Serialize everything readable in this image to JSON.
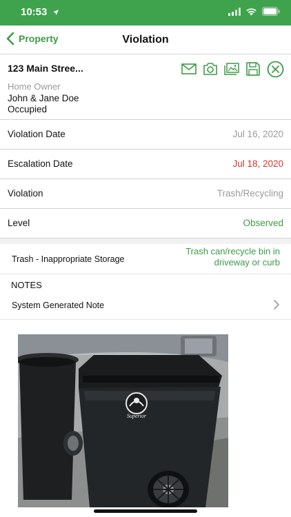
{
  "status_bar": {
    "time": "10:53",
    "background": "#3fa34d"
  },
  "nav": {
    "back_label": "Property",
    "title": "Violation",
    "accent": "#3b9b45"
  },
  "property": {
    "address": "123 Main Stree...",
    "owner_label": "Home Owner",
    "owner_name": "John & Jane Doe",
    "occupancy": "Occupied",
    "actions": [
      "mail-icon",
      "camera-icon",
      "photo-library-icon",
      "save-icon",
      "close-circle-icon"
    ]
  },
  "details": [
    {
      "label": "Violation Date",
      "value": "Jul 16, 2020",
      "color": "#9a9a9a"
    },
    {
      "label": "Escalation Date",
      "value": "Jul 18, 2020",
      "color": "#d9322b"
    },
    {
      "label": "Violation",
      "value": "Trash/Recycling",
      "color": "#9a9a9a"
    },
    {
      "label": "Level",
      "value": "Observed",
      "color": "#3b9b45"
    }
  ],
  "violation_code": {
    "label": "Trash - Inappropriate Storage",
    "description": "Trash can/recycle bin in driveway or curb"
  },
  "notes": {
    "heading": "NOTES",
    "items": [
      "System Generated Note"
    ]
  },
  "photo": {
    "logo_text": "Superior"
  }
}
